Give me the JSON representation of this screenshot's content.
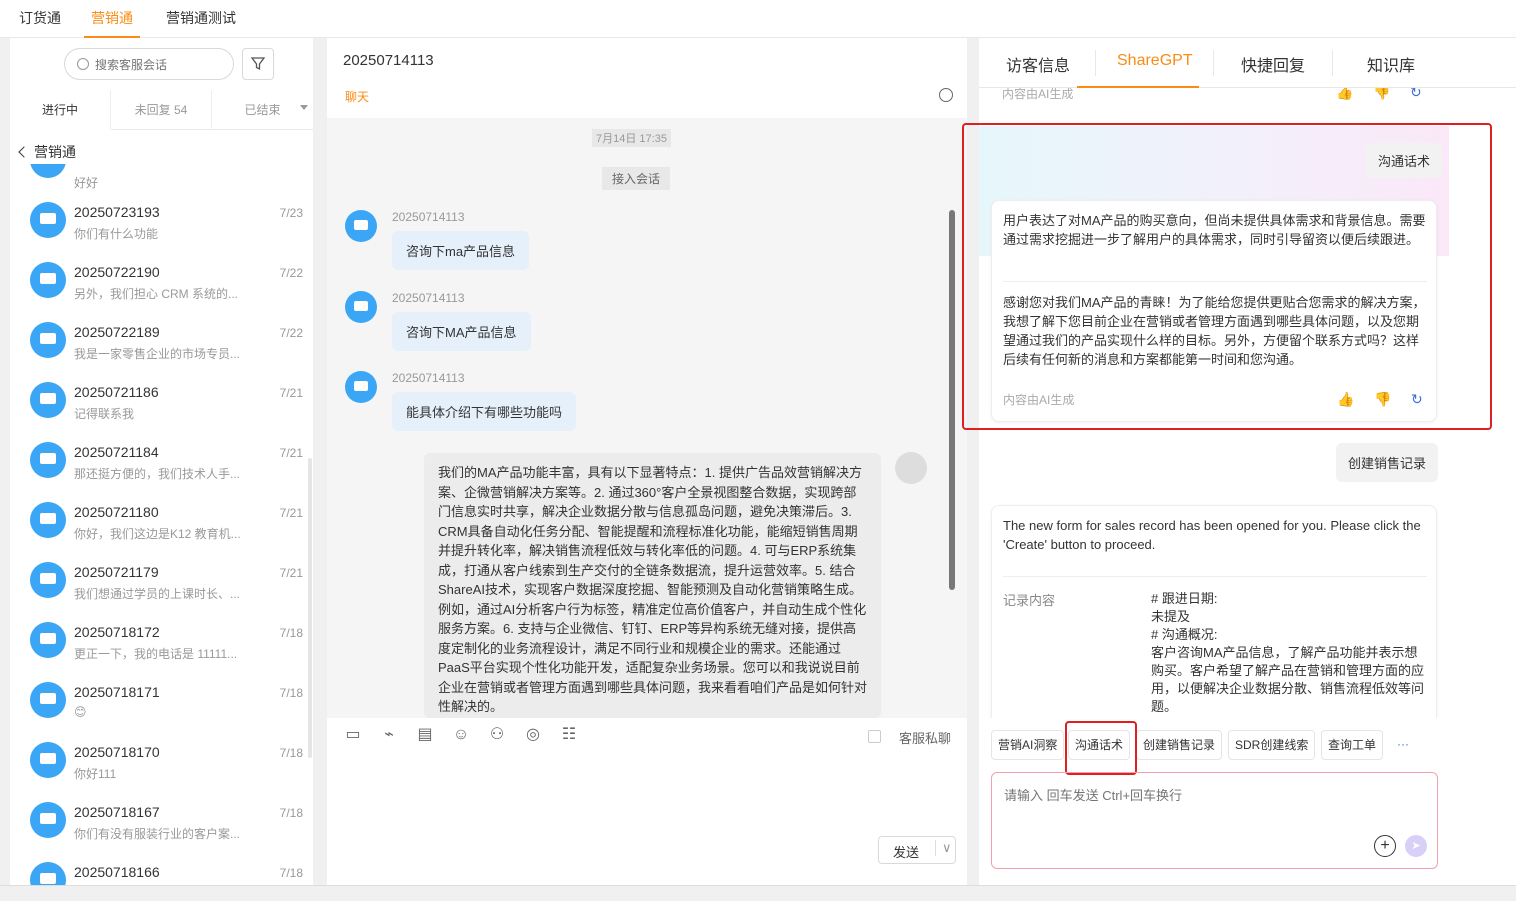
{
  "topbar": {
    "tabs": [
      "订货通",
      "营销通",
      "营销通测试"
    ],
    "active": 1
  },
  "left": {
    "search_placeholder": "搜索客服会话",
    "subtabs": [
      "进行中",
      "未回复 54",
      "已结束"
    ],
    "breadcrumb": "营销通",
    "partial_preview": "好好",
    "conversations": [
      {
        "name": "20250723193",
        "date": "7/23",
        "preview": "你们有什么功能"
      },
      {
        "name": "20250722190",
        "date": "7/22",
        "preview": "另外，我们担心 CRM 系统的..."
      },
      {
        "name": "20250722189",
        "date": "7/22",
        "preview": "我是一家零售企业的市场专员..."
      },
      {
        "name": "20250721186",
        "date": "7/21",
        "preview": "记得联系我"
      },
      {
        "name": "20250721184",
        "date": "7/21",
        "preview": "那还挺方便的，我们技术人手..."
      },
      {
        "name": "20250721180",
        "date": "7/21",
        "preview": "你好，我们这边是K12 教育机..."
      },
      {
        "name": "20250721179",
        "date": "7/21",
        "preview": "我们想通过学员的上课时长、..."
      },
      {
        "name": "20250718172",
        "date": "7/18",
        "preview": "更正一下，我的电话是 11111..."
      },
      {
        "name": "20250718171",
        "date": "7/18",
        "preview": "😊"
      },
      {
        "name": "20250718170",
        "date": "7/18",
        "preview": "你好111"
      },
      {
        "name": "20250718167",
        "date": "7/18",
        "preview": "你们有没有服装行业的客户案..."
      },
      {
        "name": "20250718166",
        "date": "7/18",
        "preview": ""
      }
    ]
  },
  "middle": {
    "title": "20250714113",
    "chat_label": "聊天",
    "timestamp": "7月14日 17:35",
    "join_label": "接入会话",
    "messages": [
      {
        "who": "20250714113",
        "text": "咨询下ma产品信息"
      },
      {
        "who": "20250714113",
        "text": "咨询下MA产品信息"
      },
      {
        "who": "20250714113",
        "text": "能具体介绍下有哪些功能吗"
      }
    ],
    "agent_reply": "我们的MA产品功能丰富，具有以下显著特点：1. 提供广告品效营销解决方案、企微营销解决方案等。2. 通过360°客户全景视图整合数据，实现跨部门信息实时共享，解决企业数据分散与信息孤岛问题，避免决策滞后。3. CRM具备自动化任务分配、智能提醒和流程标准化功能，能缩短销售周期并提升转化率，解决销售流程低效与转化率低的问题。4. 可与ERP系统集成，打通从客户线索到生产交付的全链条数据流，提升运营效率。5. 结合ShareAI技术，实现客户数据深度挖掘、智能预测及自动化营销策略生成。例如，通过AI分析客户行为标签，精准定位高价值客户，并自动生成个性化服务方案。6. 支持与企业微信、钉钉、ERP等异构系统无缝对接，提供高度定制化的业务流程设计，满足不同行业和规模企业的需求。还能通过PaaS平台实现个性化功能开发，适配复杂业务场景。您可以和我说说目前企业在营销或者管理方面遇到哪些具体问题，我来看看咱们产品是如何针对性解决的。",
    "private_label": "客服私聊",
    "send_label": "发送",
    "send_arrow": "∨"
  },
  "right": {
    "tabs": [
      "访客信息",
      "ShareGPT",
      "快捷回复",
      "知识库"
    ],
    "active": 1,
    "ai_note": "内容由AI生成",
    "q1": "沟通话术",
    "a1_analysis": "用户表达了对MA产品的购买意向，但尚未提供具体需求和背景信息。需要通过需求挖掘进一步了解用户的具体需求，同时引导留资以便后续跟进。",
    "a1_script": "感谢您对我们MA产品的青睐！为了能给您提供更贴合您需求的解决方案，我想了解下您目前企业在营销或者管理方面遇到哪些具体问题，以及您期望通过我们的产品实现什么样的目标。另外，方便留个联系方式吗？这样后续有任何新的消息和方案都能第一时间和您沟通。",
    "q2": "创建销售记录",
    "a2_text": "The new form for sales record has been opened for you. Please click the 'Create' button to proceed.",
    "record_label": "记录内容",
    "record_lines": [
      "# 跟进日期:",
      "未提及",
      "# 沟通概况:",
      "客户咨询MA产品信息，了解产品功能并表示想购买。客户希望了解产品在营销和管理方面的应用，以便解决企业数据分散、销售流程低效等问题。"
    ],
    "chips": [
      "营销AI洞察",
      "沟通话术",
      "创建销售记录",
      "SDR创建线索",
      "查询工单",
      "···"
    ],
    "input_placeholder": "请输入 回车发送 Ctrl+回车换行",
    "plus": "+",
    "send_icon": "➤"
  },
  "colors": {
    "accent": "#fa8c16",
    "avatar": "#3aa6f5",
    "highlight": "#e02020"
  }
}
